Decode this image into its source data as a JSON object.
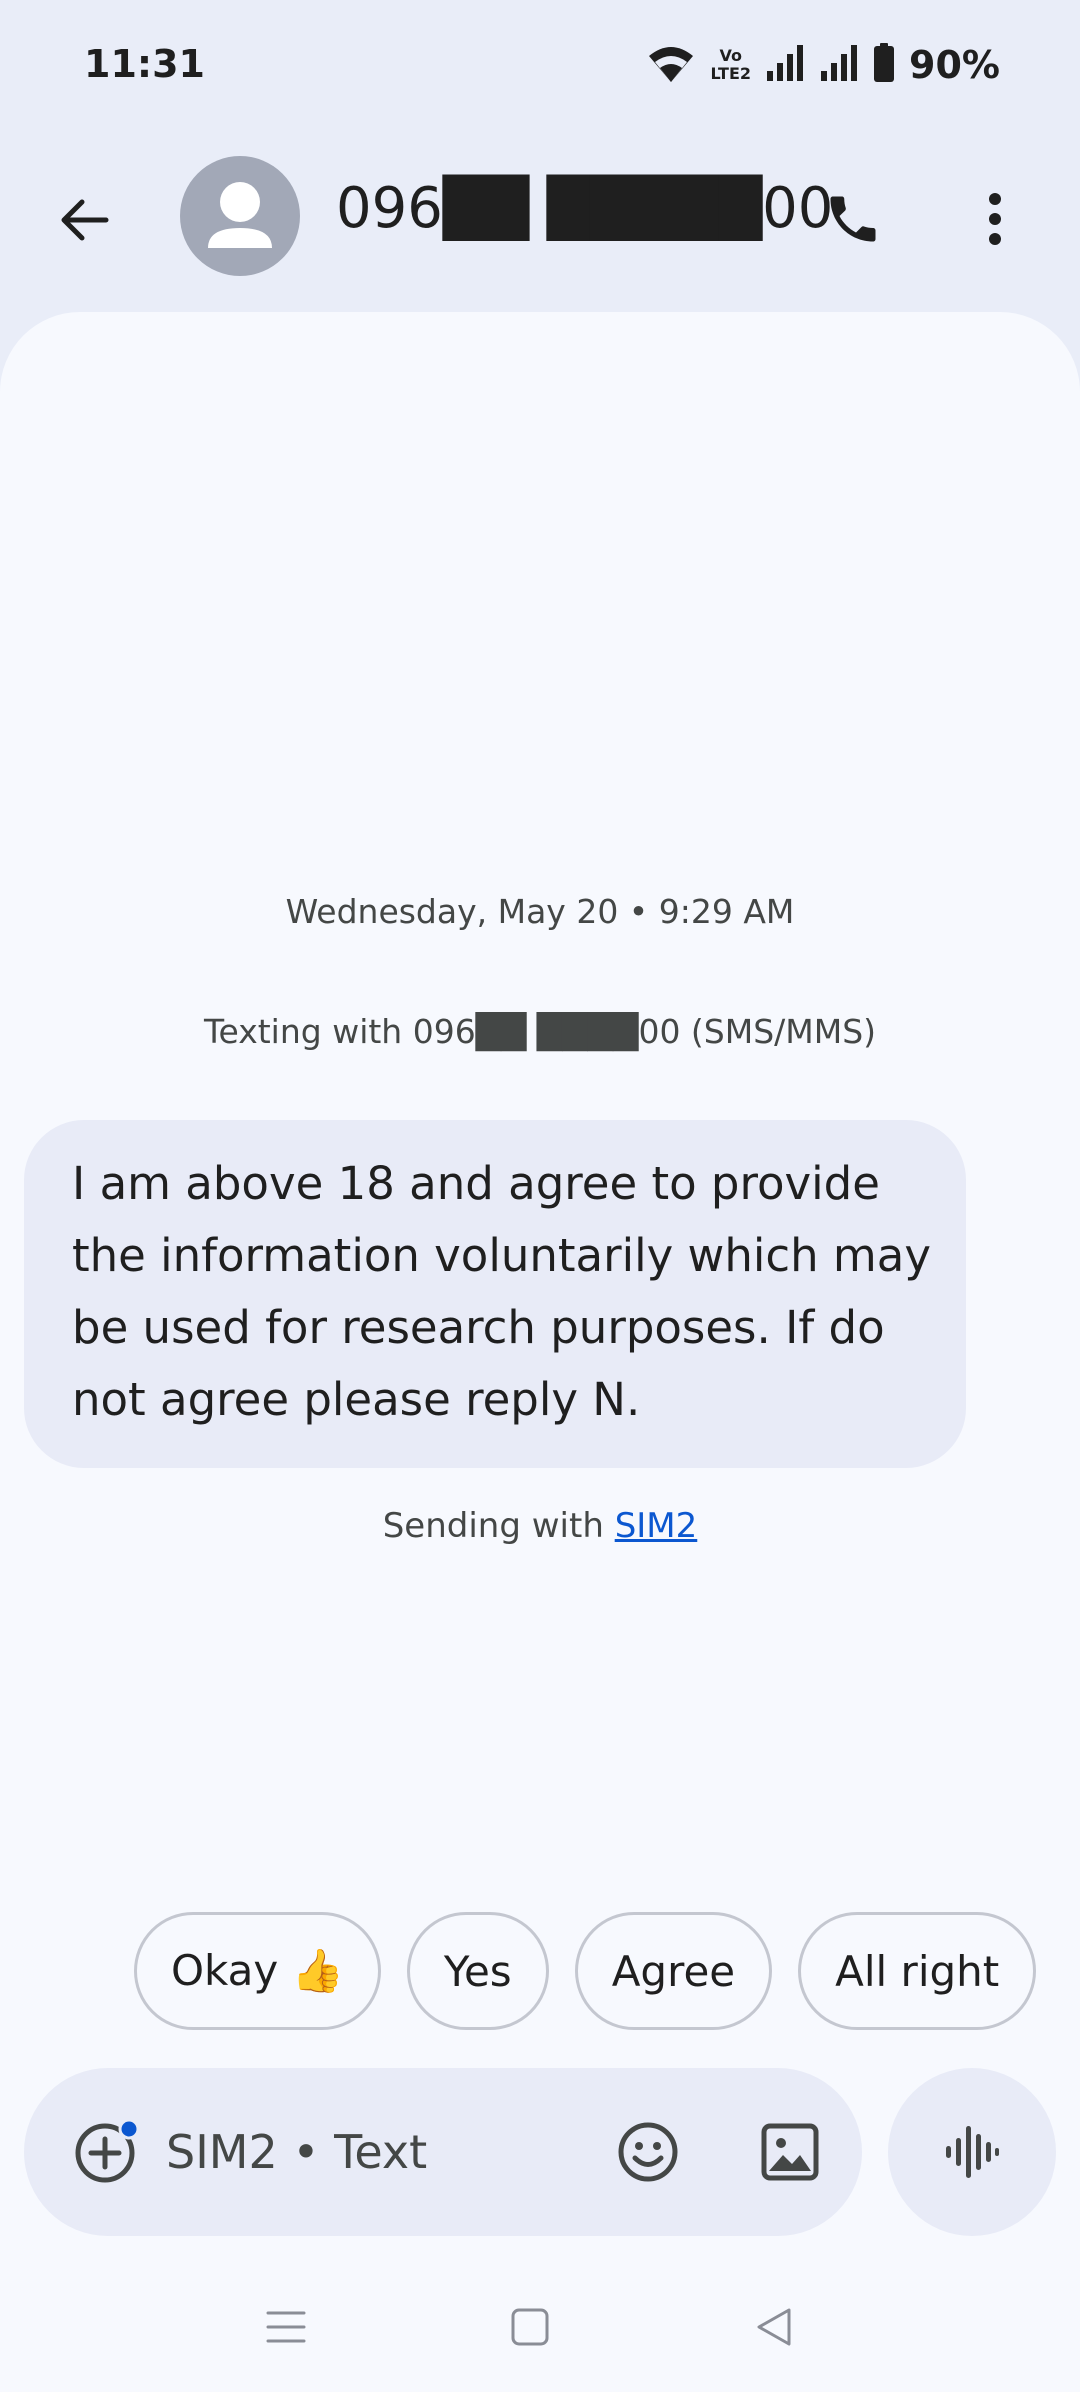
{
  "status_bar": {
    "time": "11:31",
    "volte_line1": "Vo",
    "volte_line2": "LTE2",
    "battery": "90%"
  },
  "header": {
    "contact": "096██ █████00"
  },
  "conversation": {
    "date": "Wednesday, May 20 • 9:29 AM",
    "texting_with": "Texting with 096██ ████00 (SMS/MMS)",
    "message": "I am above 18 and agree to provide the information voluntarily which may be used for research purposes. If do not agree please reply N.",
    "sending_prefix": "Sending with ",
    "sending_sim": "SIM2"
  },
  "suggestions": [
    "Okay 👍",
    "Yes",
    "Agree",
    "All right"
  ],
  "compose": {
    "placeholder": "SIM2 • Text"
  },
  "colors": {
    "accent": "#0b57d0",
    "surface": "#f7f9fe",
    "header_bg": "#e9edf8",
    "bubble": "#e8ebf7",
    "avatar": "#a2a8b7"
  },
  "icons": {
    "back": "arrow-back-icon",
    "call": "phone-icon",
    "more": "more-vert-icon",
    "attach": "add-circle-icon",
    "emoji": "emoji-icon",
    "image": "image-icon",
    "voice": "voice-waveform-icon",
    "nav_recents": "menu-lines-icon",
    "nav_home": "square-home-icon",
    "nav_back": "triangle-back-icon"
  }
}
